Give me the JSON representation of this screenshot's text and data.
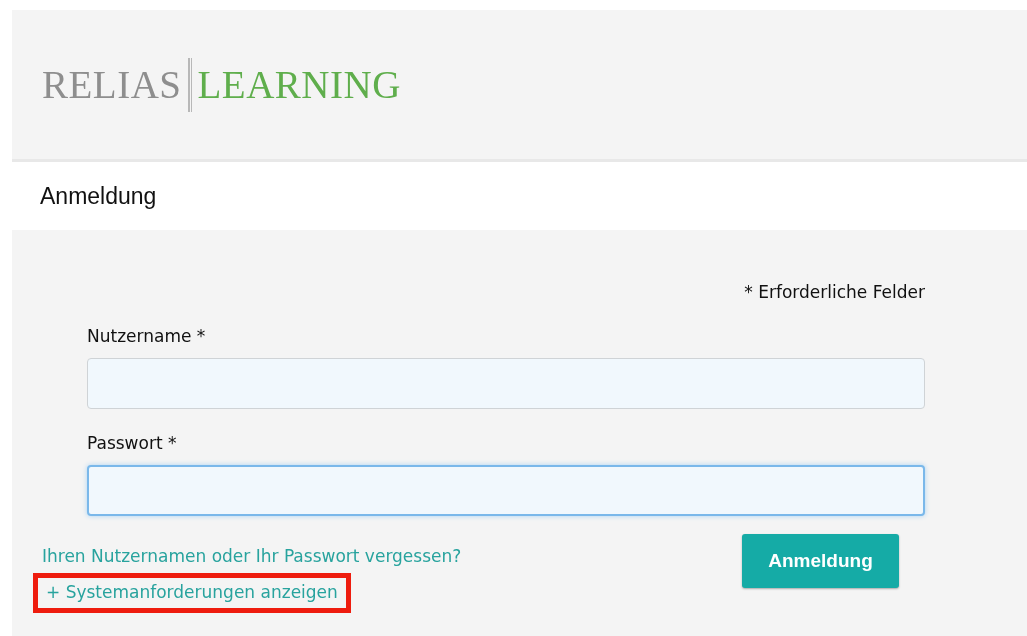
{
  "logo": {
    "primary": "RELIAS",
    "secondary": "LEARNING"
  },
  "title": "Anmeldung",
  "required_note": "* Erforderliche Felder",
  "fields": [
    {
      "label": "Nutzername *",
      "focused": false
    },
    {
      "label": "Passwort *",
      "focused": true
    }
  ],
  "links": [
    {
      "text": "Ihren Nutzernamen oder Ihr Passwort vergessen?",
      "highlighted": false
    },
    {
      "text": "+ Systemanforderungen anzeigen",
      "highlighted": true
    }
  ],
  "submit_button": "Anmeldung"
}
